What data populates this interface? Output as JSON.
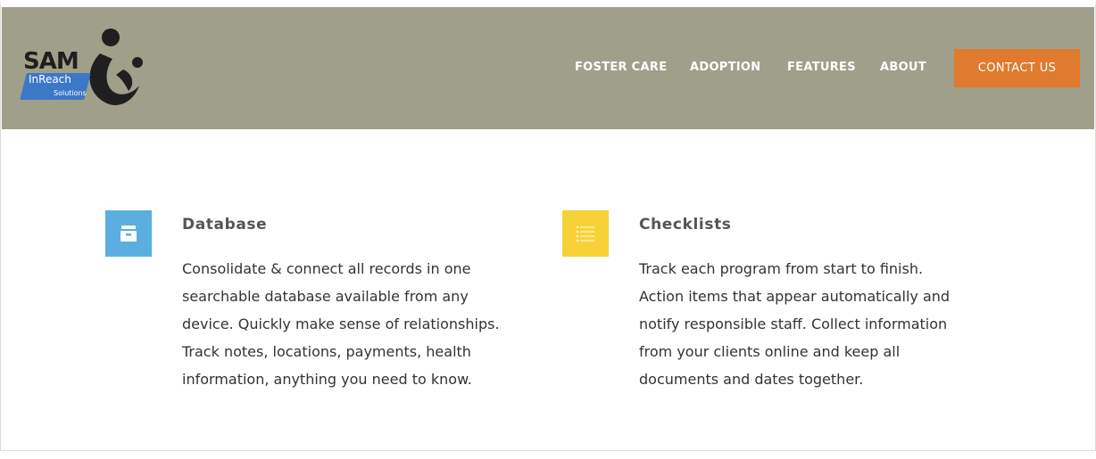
{
  "logo": {
    "brand": "SAM",
    "tag_line1": "InReach",
    "tag_line2": "Solutions"
  },
  "nav": {
    "items": [
      {
        "label": "FOSTER CARE"
      },
      {
        "label": "ADOPTION"
      },
      {
        "label": "FEATURES"
      },
      {
        "label": "ABOUT"
      }
    ],
    "contact_label": "CONTACT US"
  },
  "colors": {
    "header_bg": "#a09f89",
    "contact_bg": "#e07a2e",
    "database_icon_bg": "#5aafe0",
    "checklists_icon_bg": "#f7d237"
  },
  "features": [
    {
      "icon": "archive-drawer-icon",
      "title": "Database",
      "lines": [
        "Consolidate & connect all records in one",
        "searchable database available from any",
        "device. Quickly make sense of relationships.",
        "Track notes, locations, payments, health",
        "information, anything you need to know."
      ]
    },
    {
      "icon": "checklist-icon",
      "title": "Checklists",
      "lines": [
        "Track each program from start to finish.",
        "Action items that appear automatically and",
        "notify responsible staff. Collect information",
        "from your clients online and keep all",
        "documents and dates together."
      ]
    }
  ]
}
